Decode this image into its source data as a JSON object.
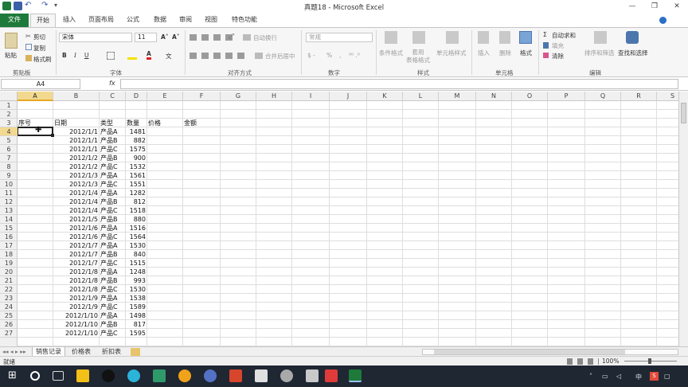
{
  "window": {
    "title": "真题18 - Microsoft Excel",
    "controls": {
      "minimize": "—",
      "restore": "❐",
      "close": "✕"
    }
  },
  "ribbon_tabs": [
    "文件",
    "开始",
    "插入",
    "页面布局",
    "公式",
    "数据",
    "审阅",
    "视图",
    "特色功能"
  ],
  "active_tab": "开始",
  "ribbon": {
    "clipboard": {
      "label": "剪贴板",
      "paste": "粘贴",
      "cut": "剪切",
      "copy": "复制",
      "format_painter": "格式刷"
    },
    "font": {
      "label": "字体",
      "name": "宋体",
      "size": "11"
    },
    "alignment": {
      "label": "对齐方式",
      "wrap": "自动换行",
      "merge": "合并后居中"
    },
    "number": {
      "label": "数字",
      "format": "常规"
    },
    "styles": {
      "label": "样式",
      "conditional": "条件格式",
      "table": "套用\n表格格式",
      "cell_styles": "单元格样式"
    },
    "cells": {
      "label": "单元格",
      "insert": "插入",
      "delete": "删除",
      "format": "格式"
    },
    "editing": {
      "label": "编辑",
      "autosum": "自动求和",
      "fill": "填充",
      "clear": "清除",
      "sort": "排序和筛选",
      "find": "查找和选择"
    }
  },
  "formula_bar": {
    "name_box": "A4",
    "fx": "fx",
    "value": ""
  },
  "columns": [
    "A",
    "B",
    "C",
    "D",
    "E",
    "F",
    "G",
    "H",
    "I",
    "J",
    "K",
    "L",
    "M",
    "N",
    "O",
    "P",
    "Q",
    "R",
    "S"
  ],
  "selected_column": "A",
  "selected_row": 4,
  "rows": [
    1,
    2,
    3,
    4,
    5,
    6,
    7,
    8,
    9,
    10,
    11,
    12,
    13,
    14,
    15,
    16,
    17,
    18,
    19,
    20,
    21,
    22,
    23,
    24,
    25,
    26,
    27
  ],
  "headers": {
    "A": "序号",
    "B": "日期",
    "C": "类型",
    "D": "数量",
    "E": "价格",
    "F": "金额"
  },
  "data": [
    [
      "2012/1/1",
      "产品A",
      "1481"
    ],
    [
      "2012/1/1",
      "产品B",
      "882"
    ],
    [
      "2012/1/1",
      "产品C",
      "1575"
    ],
    [
      "2012/1/2",
      "产品B",
      "900"
    ],
    [
      "2012/1/2",
      "产品C",
      "1532"
    ],
    [
      "2012/1/3",
      "产品A",
      "1561"
    ],
    [
      "2012/1/3",
      "产品C",
      "1551"
    ],
    [
      "2012/1/4",
      "产品A",
      "1282"
    ],
    [
      "2012/1/4",
      "产品B",
      "812"
    ],
    [
      "2012/1/4",
      "产品C",
      "1518"
    ],
    [
      "2012/1/5",
      "产品B",
      "880"
    ],
    [
      "2012/1/6",
      "产品A",
      "1516"
    ],
    [
      "2012/1/6",
      "产品C",
      "1564"
    ],
    [
      "2012/1/7",
      "产品A",
      "1530"
    ],
    [
      "2012/1/7",
      "产品B",
      "840"
    ],
    [
      "2012/1/7",
      "产品C",
      "1515"
    ],
    [
      "2012/1/8",
      "产品A",
      "1248"
    ],
    [
      "2012/1/8",
      "产品B",
      "993"
    ],
    [
      "2012/1/8",
      "产品C",
      "1530"
    ],
    [
      "2012/1/9",
      "产品A",
      "1538"
    ],
    [
      "2012/1/9",
      "产品C",
      "1589"
    ],
    [
      "2012/1/10",
      "产品A",
      "1498"
    ],
    [
      "2012/1/10",
      "产品B",
      "817"
    ],
    [
      "2012/1/10",
      "产品C",
      "1595"
    ]
  ],
  "sheets": [
    "销售记录",
    "价格表",
    "折扣表"
  ],
  "active_sheet": "销售记录",
  "status": {
    "ready": "就绪",
    "zoom": "100%"
  },
  "taskbar": {
    "ime": "中",
    "lang_icon": "S"
  }
}
